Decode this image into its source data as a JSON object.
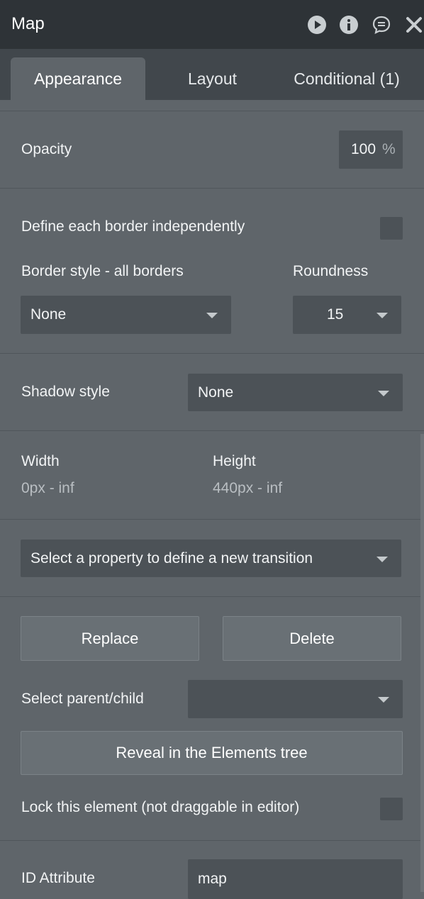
{
  "header": {
    "title": "Map",
    "icons": [
      "play-icon",
      "info-icon",
      "comment-icon",
      "close-icon"
    ]
  },
  "tabs": [
    {
      "label": "Appearance",
      "active": true
    },
    {
      "label": "Layout",
      "active": false
    },
    {
      "label": "Conditional (1)",
      "active": false
    }
  ],
  "opacity": {
    "label": "Opacity",
    "value": "100",
    "unit": "%"
  },
  "border": {
    "independent_label": "Define each border independently",
    "independent_checked": false,
    "style_label": "Border style - all borders",
    "style_value": "None",
    "roundness_label": "Roundness",
    "roundness_value": "15"
  },
  "shadow": {
    "label": "Shadow style",
    "value": "None"
  },
  "size": {
    "width_label": "Width",
    "width_value": "0px - inf",
    "height_label": "Height",
    "height_value": "440px - inf"
  },
  "transition": {
    "placeholder": "Select a property to define a new transition"
  },
  "actions": {
    "replace": "Replace",
    "delete": "Delete",
    "parent_child_label": "Select parent/child",
    "parent_child_value": "",
    "reveal": "Reveal in the Elements tree",
    "lock_label": "Lock this element (not draggable in editor)",
    "lock_checked": false
  },
  "id_attribute": {
    "label": "ID Attribute",
    "value": "map"
  },
  "colors": {
    "panel_bg": "#5f656a",
    "title_bg": "#2e3337",
    "tab_bar_bg": "#41474c",
    "field_bg": "#4c5257",
    "button_bg": "#697075"
  }
}
